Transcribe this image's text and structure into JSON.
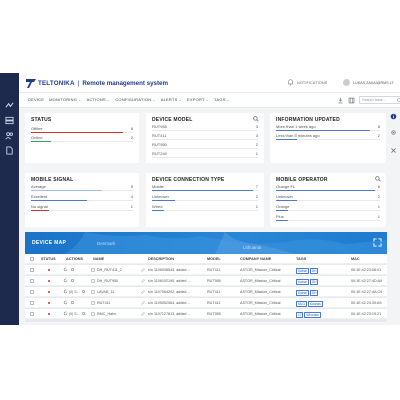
{
  "app": {
    "brand": "TELTONIKA",
    "separator": "|",
    "title": "Remote management system",
    "notifications_label": "NOTIFICATIONS",
    "user_email": "LUKAS.ZAKAI@RMS.LT"
  },
  "colors": {
    "navy": "#1e2a4d",
    "brand_blue": "#1f3a8a",
    "red": "#d0342c",
    "green": "#3aa55d",
    "blue": "#4a7bd0",
    "light_blue": "#9fc0e6",
    "map_blue": "#1a73c7"
  },
  "menu": {
    "items": [
      "DEVICE",
      "MONITORING",
      "ACTIONS",
      "CONFIGURATION",
      "ALERTS",
      "EXPORT",
      "TAGS"
    ],
    "caret": "⌄",
    "search_placeholder": "Search table..."
  },
  "cards": {
    "status": {
      "title": "STATUS",
      "rows": [
        {
          "label": "Offline",
          "value": "8",
          "fraction": 0.9,
          "color": "#d0342c"
        },
        {
          "label": "Online",
          "value": "2",
          "fraction": 0.2,
          "color": "#3aa55d"
        }
      ]
    },
    "device_model": {
      "title": "DEVICE MODEL",
      "rows": [
        {
          "label": "RUT955",
          "value": "3",
          "fraction": 0.0,
          "color": "#4a7bd0"
        },
        {
          "label": "RUT411",
          "value": "3",
          "fraction": 0.0,
          "color": "#4a7bd0"
        },
        {
          "label": "RUT950",
          "value": "2",
          "fraction": 0.0,
          "color": "#4a7bd0"
        },
        {
          "label": "RUT240",
          "value": "1",
          "fraction": 0.0,
          "color": "#4a7bd0"
        }
      ]
    },
    "information_updated": {
      "title": "INFORMATION UPDATED",
      "rows": [
        {
          "label": "More than 1 week ago",
          "value": "8",
          "fraction": 0.9,
          "color": "#4a7bd0"
        },
        {
          "label": "Less than 5 minutes ago",
          "value": "2",
          "fraction": 0.2,
          "color": "#4a7bd0"
        }
      ]
    },
    "mobile_signal": {
      "title": "MOBILE SIGNAL",
      "rows": [
        {
          "label": "Average",
          "value": "5",
          "fraction": 0.7,
          "color": "#9fc0e6"
        },
        {
          "label": "Excellent",
          "value": "4",
          "fraction": 0.55,
          "color": "#4a7bd0"
        },
        {
          "label": "No signal",
          "value": "1",
          "fraction": 0.18,
          "color": "#d0342c"
        }
      ]
    },
    "device_connection_type": {
      "title": "DEVICE CONNECTION TYPE",
      "rows": [
        {
          "label": "Mobile",
          "value": "7",
          "fraction": 0.95,
          "color": "#4a7bd0"
        },
        {
          "label": "Unknown",
          "value": "2",
          "fraction": 0.22,
          "color": "#4a7bd0"
        },
        {
          "label": "Wired",
          "value": "1",
          "fraction": 0.11,
          "color": "#4a7bd0"
        }
      ]
    },
    "mobile_operator": {
      "title": "MOBILE OPERATOR",
      "rows": [
        {
          "label": "Orange FL",
          "value": "6",
          "fraction": 0.95,
          "color": "#4a7bd0"
        },
        {
          "label": "Unknown",
          "value": "2",
          "fraction": 0.2,
          "color": "#4a7bd0"
        },
        {
          "label": "Orange",
          "value": "1",
          "fraction": 0.12,
          "color": "#4a7bd0"
        },
        {
          "label": "Plus",
          "value": "1",
          "fraction": 0.12,
          "color": "#4a7bd0"
        }
      ]
    }
  },
  "map": {
    "title": "DEVICE MAP",
    "labels": [
      "Denmark",
      "Lithuania"
    ]
  },
  "table": {
    "headers": [
      "STATUS",
      "ACTIONS",
      "NAME",
      "DESCRIPTION",
      "MODEL",
      "COMPANY NAME",
      "TAGS",
      "MAC"
    ],
    "rows": [
      {
        "name": "DH_RUT411_2",
        "description": "s/n 1106938543, added ...",
        "model": "RUT411",
        "company": "ASTOR_Mission_Critical",
        "tags": [
          "Kalnai",
          "DH"
        ],
        "mac": "00:1E:42:23:08:01"
      },
      {
        "name": "DH_RUT955",
        "description": "s/n 1106102190, added ...",
        "model": "RUT955",
        "company": "ASTOR_Mission_Critical",
        "tags": [
          "Kalnai",
          "DH"
        ],
        "mac": "00:1E:42:27:4D:A9"
      },
      {
        "name": "LAVAR_11",
        "description": "s/n 1107064202, added ...",
        "model": "RUT411",
        "company": "ASTOR_Mission_Critical",
        "tags": [
          "Kalnai",
          "DH"
        ],
        "mac": "00:1E:42:27:4A:C9"
      },
      {
        "name": "RUT411",
        "description": "s/n 1105052064, added ...",
        "model": "RUT411",
        "company": "ASTOR_Mission_Critical",
        "tags": [
          "MLG",
          "Kaunas"
        ],
        "mac": "00:1E:42:24:30:A9"
      },
      {
        "name": "RMC_Hahn",
        "description": "s/n 1107127813, added ...",
        "model": "RUT955",
        "company": "ASTOR_Mission_Critical",
        "tags": [
          "LT",
          "Wroclaw"
        ],
        "mac": "00:1E:42:23:19:21"
      }
    ],
    "action_counts": [
      "",
      "",
      "(0) S...",
      "",
      "(0) S..."
    ]
  }
}
